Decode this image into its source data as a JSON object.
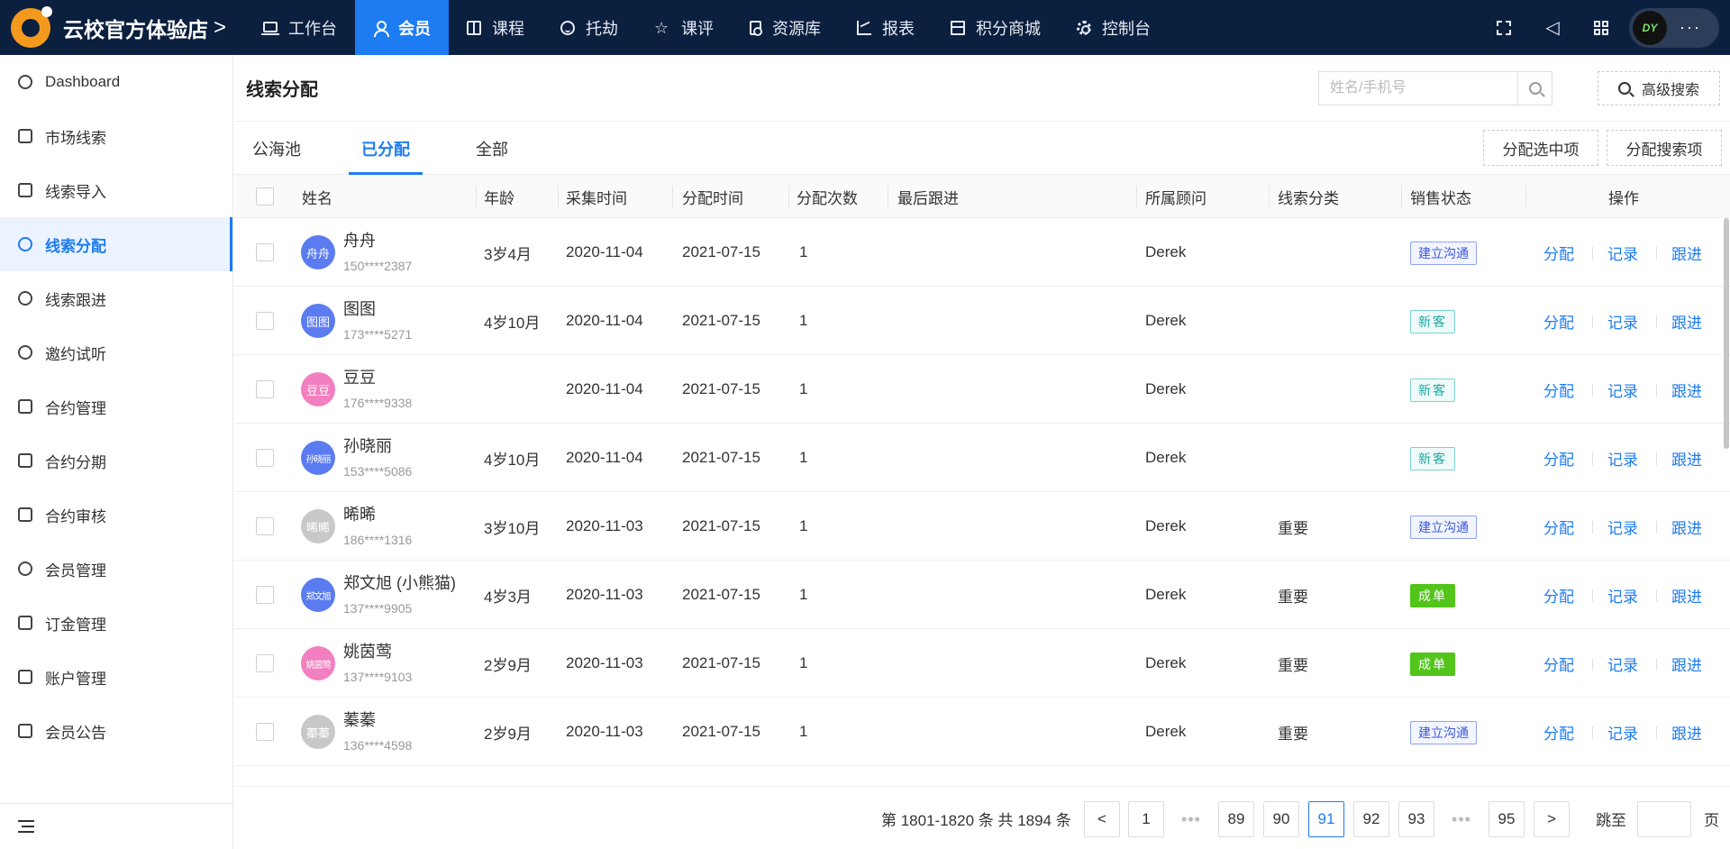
{
  "topbar": {
    "brand": "云校官方体验店",
    "brand_chevron": ">",
    "nav": [
      {
        "label": "工作台",
        "icon": "laptop-icon"
      },
      {
        "label": "会员",
        "icon": "user-icon"
      },
      {
        "label": "课程",
        "icon": "book-icon"
      },
      {
        "label": "托劫",
        "icon": "smile-icon"
      },
      {
        "label": "课评",
        "icon": "star-icon"
      },
      {
        "label": "资源库",
        "icon": "document-search-icon"
      },
      {
        "label": "报表",
        "icon": "chart-icon"
      },
      {
        "label": "积分商城",
        "icon": "shop-icon"
      },
      {
        "label": "控制台",
        "icon": "gear-icon"
      }
    ],
    "active_nav": "会员",
    "user_avatar_text": "DY",
    "user_menu": "···"
  },
  "sidebar": {
    "items": [
      {
        "label": "Dashboard",
        "icon": "dashboard-icon"
      },
      {
        "label": "市场线索",
        "icon": "search-doc-icon"
      },
      {
        "label": "线索导入",
        "icon": "import-icon"
      },
      {
        "label": "线索分配",
        "icon": "share-icon"
      },
      {
        "label": "线索跟进",
        "icon": "chat-icon"
      },
      {
        "label": "邀约试听",
        "icon": "user-invite-icon"
      },
      {
        "label": "合约管理",
        "icon": "contract-icon"
      },
      {
        "label": "合约分期",
        "icon": "installment-icon"
      },
      {
        "label": "合约审核",
        "icon": "review-icon"
      },
      {
        "label": "会员管理",
        "icon": "members-icon"
      },
      {
        "label": "订金管理",
        "icon": "deposit-icon"
      },
      {
        "label": "账户管理",
        "icon": "account-icon"
      },
      {
        "label": "会员公告",
        "icon": "announcement-icon"
      }
    ],
    "active": "线索分配"
  },
  "main": {
    "title": "线索分配",
    "search_placeholder": "姓名/手机号",
    "advanced_search": "高级搜索",
    "tabs": [
      "公海池",
      "已分配",
      "全部"
    ],
    "active_tab": "已分配",
    "assign_selected": "分配选中项",
    "assign_search": "分配搜索项"
  },
  "table": {
    "columns": [
      "姓名",
      "年龄",
      "采集时间",
      "分配时间",
      "分配次数",
      "最后跟进",
      "所属顾问",
      "线索分类",
      "销售状态",
      "操作"
    ],
    "actions": [
      "分配",
      "记录",
      "跟进"
    ],
    "rows": [
      {
        "avatar": "舟舟",
        "avatar_color": "#5b7cf0",
        "name": "舟舟",
        "phone": "150****2387",
        "age": "3岁4月",
        "collected": "2020-11-04",
        "assigned": "2021-07-15",
        "count": "1",
        "last_follow": "",
        "advisor": "Derek",
        "category": "",
        "status": "建立沟通",
        "status_type": "comm"
      },
      {
        "avatar": "图图",
        "avatar_color": "#5b7cf0",
        "name": "图图",
        "phone": "173****5271",
        "age": "4岁10月",
        "collected": "2020-11-04",
        "assigned": "2021-07-15",
        "count": "1",
        "last_follow": "",
        "advisor": "Derek",
        "category": "",
        "status": "新客",
        "status_type": "new"
      },
      {
        "avatar": "豆豆",
        "avatar_color": "#f27fbf",
        "name": "豆豆",
        "phone": "176****9338",
        "age": "",
        "collected": "2020-11-04",
        "assigned": "2021-07-15",
        "count": "1",
        "last_follow": "",
        "advisor": "Derek",
        "category": "",
        "status": "新客",
        "status_type": "new"
      },
      {
        "avatar": "孙晓丽",
        "avatar_color": "#5b7cf0",
        "name": "孙晓丽",
        "phone": "153****5086",
        "age": "4岁10月",
        "collected": "2020-11-04",
        "assigned": "2021-07-15",
        "count": "1",
        "last_follow": "",
        "advisor": "Derek",
        "category": "",
        "status": "新客",
        "status_type": "new"
      },
      {
        "avatar": "晞晞",
        "avatar_color": "#c8c8c8",
        "name": "晞晞",
        "phone": "186****1316",
        "age": "3岁10月",
        "collected": "2020-11-03",
        "assigned": "2021-07-15",
        "count": "1",
        "last_follow": "",
        "advisor": "Derek",
        "category": "重要",
        "status": "建立沟通",
        "status_type": "comm"
      },
      {
        "avatar": "郑文旭",
        "avatar_color": "#5b7cf0",
        "name": "郑文旭 (小熊猫)",
        "phone": "137****9905",
        "age": "4岁3月",
        "collected": "2020-11-03",
        "assigned": "2021-07-15",
        "count": "1",
        "last_follow": "",
        "advisor": "Derek",
        "category": "重要",
        "status": "成单",
        "status_type": "deal"
      },
      {
        "avatar": "姚茵莺",
        "avatar_color": "#f27fbf",
        "name": "姚茵莺",
        "phone": "137****9103",
        "age": "2岁9月",
        "collected": "2020-11-03",
        "assigned": "2021-07-15",
        "count": "1",
        "last_follow": "",
        "advisor": "Derek",
        "category": "重要",
        "status": "成单",
        "status_type": "deal"
      },
      {
        "avatar": "蓁蓁",
        "avatar_color": "#c8c8c8",
        "name": "蓁蓁",
        "phone": "136****4598",
        "age": "2岁9月",
        "collected": "2020-11-03",
        "assigned": "2021-07-15",
        "count": "1",
        "last_follow": "",
        "advisor": "Derek",
        "category": "重要",
        "status": "建立沟通",
        "status_type": "comm"
      }
    ]
  },
  "pagination": {
    "total_text": "第 1801-1820 条 共 1894 条",
    "prev": "<",
    "next": ">",
    "pages": [
      "1",
      "89",
      "90",
      "91",
      "92",
      "93",
      "95"
    ],
    "current": "91",
    "ellipsis": "•••",
    "jump_label": "跳至",
    "page_unit": "页"
  },
  "colors": {
    "topbar_bg": "#0b1f3f",
    "accent": "#1d7cf2",
    "deal_green": "#52c41a"
  }
}
